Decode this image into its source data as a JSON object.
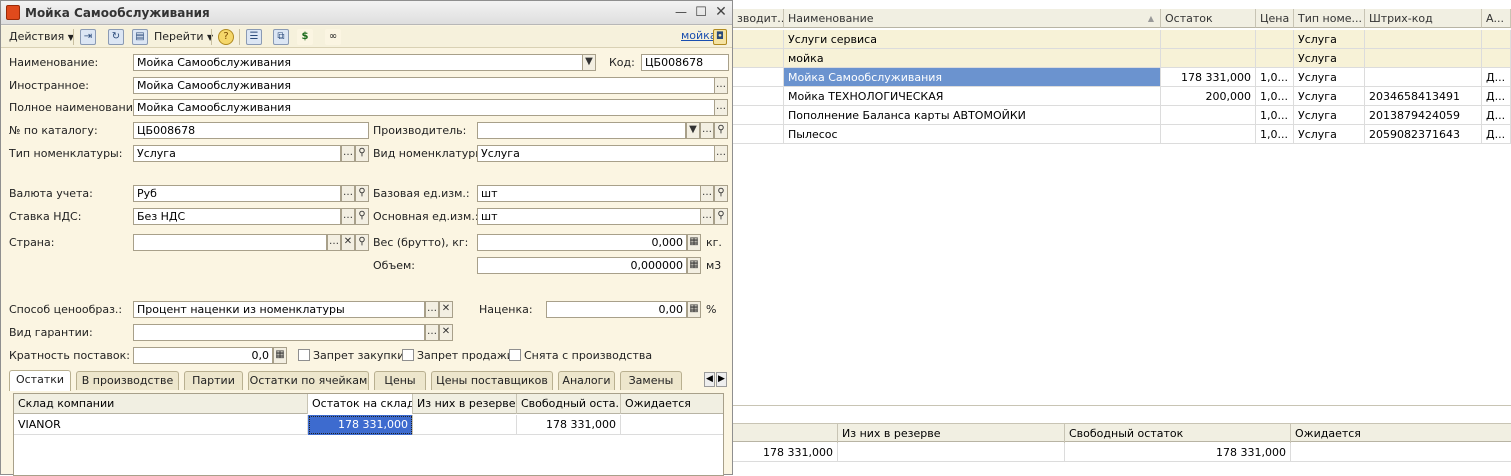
{
  "list": {
    "headers": {
      "producer": "зводит...",
      "name": "Наименование",
      "stock": "Остаток",
      "price": "Цена",
      "type": "Тип номе...",
      "barcode": "Штрих-код",
      "extra": "А..."
    },
    "group_rows": [
      {
        "name": "Услуги сервиса",
        "type": "Услуга"
      },
      {
        "name": "мойка",
        "type": "Услуга"
      }
    ],
    "rows": [
      {
        "name": "Мойка Самообслуживания",
        "stock": "178 331,000",
        "price": "1,0...",
        "type": "Услуга",
        "barcode": "",
        "extra": "Д..."
      },
      {
        "name": "Мойка ТЕХНОЛОГИЧЕСКАЯ",
        "stock": "200,000",
        "price": "1,0...",
        "type": "Услуга",
        "barcode": "2034658413491",
        "extra": "Д..."
      },
      {
        "name": "Пополнение Баланса карты АВТОМОЙКИ",
        "stock": "",
        "price": "1,0...",
        "type": "Услуга",
        "barcode": "2013879424059",
        "extra": "Д..."
      },
      {
        "name": "Пылесос",
        "stock": "",
        "price": "1,0...",
        "type": "Услуга",
        "barcode": "2059082371643",
        "extra": "Д..."
      }
    ]
  },
  "bottom_panel": {
    "headers": {
      "reserve": "Из них в резерве",
      "free": "Свободный остаток",
      "expected": "Ожидается"
    },
    "row": {
      "stock": "178 331,000",
      "free": "178 331,000"
    }
  },
  "window": {
    "title": "Мойка Самообслуживания",
    "toolbar": {
      "actions": "Действия",
      "goto": "Перейти",
      "link": "мойка"
    }
  },
  "form": {
    "name_label": "Наименование:",
    "name_value": "Мойка Самообслуживания",
    "code_label": "Код:",
    "code_value": "ЦБ008678",
    "foreign_label": "Иностранное:",
    "foreign_value": "Мойка Самообслуживания",
    "fullname_label": "Полное наименование:",
    "fullname_value": "Мойка Самообслуживания",
    "catalog_label": "№ по каталогу:",
    "catalog_value": "ЦБ008678",
    "producer_label": "Производитель:",
    "producer_value": "",
    "nomtype_label": "Тип номенклатуры:",
    "nomtype_value": "Услуга",
    "nomkind_label": "Вид номенклатуры:",
    "nomkind_value": "Услуга",
    "currency_label": "Валюта учета:",
    "currency_value": "Руб",
    "baseunit_label": "Базовая ед.изм.:",
    "baseunit_value": "шт",
    "vat_label": "Ставка НДС:",
    "vat_value": "Без НДС",
    "mainunit_label": "Основная ед.изм.:",
    "mainunit_value": "шт",
    "country_label": "Страна:",
    "country_value": "",
    "weight_label": "Вес (брутто), кг:",
    "weight_value": "0,000",
    "weight_unit": "кг.",
    "volume_label": "Объем:",
    "volume_value": "0,000000",
    "volume_unit": "м3",
    "pricing_label": "Способ ценообраз.:",
    "pricing_value": "Процент наценки из номенклатуры",
    "markup_label": "Наценка:",
    "markup_value": "0,00",
    "markup_unit": "%",
    "warranty_label": "Вид гарантии:",
    "warranty_value": "",
    "multiplicity_label": "Кратность поставок:",
    "multiplicity_value": "0,0",
    "chk_purchase": "Запрет закупки",
    "chk_sale": "Запрет продажи",
    "chk_discontinued": "Снята с производства"
  },
  "tabs": [
    "Остатки",
    "В производстве",
    "Партии",
    "Остатки по ячейкам",
    "Цены",
    "Цены поставщиков",
    "Аналоги",
    "Замены"
  ],
  "stock_grid": {
    "headers": {
      "warehouse": "Склад компании",
      "stock": "Остаток на складе",
      "reserve": "Из них в резерве",
      "free": "Свободный оста...",
      "expected": "Ожидается"
    },
    "rows": [
      {
        "warehouse": "VIANOR",
        "stock": "178 331,000",
        "reserve": "",
        "free": "178 331,000",
        "expected": ""
      }
    ]
  }
}
